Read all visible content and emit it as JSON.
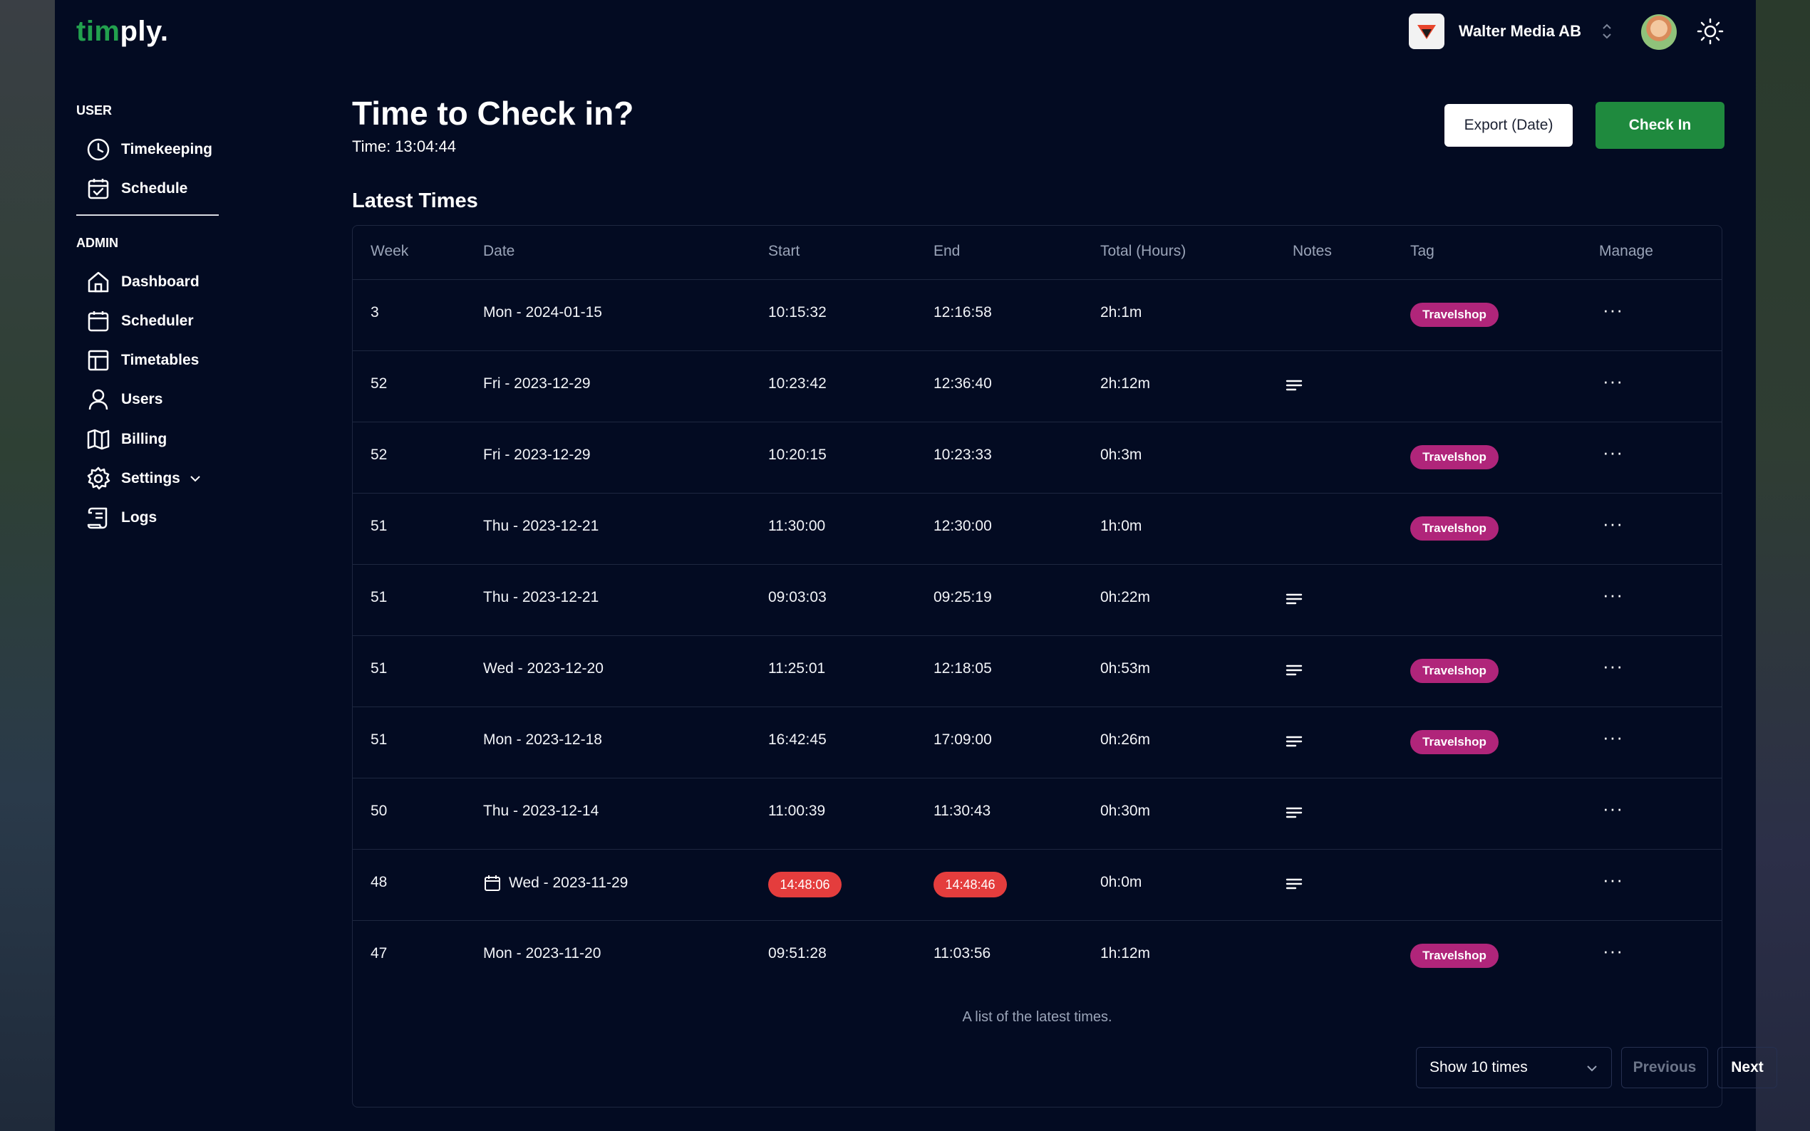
{
  "app": {
    "logo_part1": "tim",
    "logo_part2": "ply.",
    "brand_color": "#22a04e"
  },
  "header": {
    "org_name": "Walter Media AB",
    "theme_icon": "sun-icon"
  },
  "sidebar": {
    "user_section": "USER",
    "user_items": [
      {
        "label": "Timekeeping",
        "icon": "clock-icon"
      },
      {
        "label": "Schedule",
        "icon": "calendar-check-icon"
      }
    ],
    "admin_section": "ADMIN",
    "admin_items": [
      {
        "label": "Dashboard",
        "icon": "home-icon"
      },
      {
        "label": "Scheduler",
        "icon": "calendar-icon"
      },
      {
        "label": "Timetables",
        "icon": "table-icon"
      },
      {
        "label": "Users",
        "icon": "user-icon"
      },
      {
        "label": "Billing",
        "icon": "map-icon"
      },
      {
        "label": "Settings",
        "icon": "gear-icon"
      },
      {
        "label": "Logs",
        "icon": "scroll-icon"
      }
    ]
  },
  "main": {
    "title": "Time to Check in?",
    "time_text": "Time: 13:04:44",
    "export_label": "Export (Date)",
    "checkin_label": "Check In",
    "section_title": "Latest Times"
  },
  "table": {
    "headers": [
      "Week",
      "Date",
      "Start",
      "End",
      "Total (Hours)",
      "Notes",
      "Tag",
      "Manage"
    ],
    "rows": [
      {
        "week": "3",
        "date": "Mon - 2024-01-15",
        "start": "10:15:32",
        "end": "12:16:58",
        "total": "2h:1m",
        "notes": false,
        "tag": "Travelshop"
      },
      {
        "week": "52",
        "date": "Fri - 2023-12-29",
        "start": "10:23:42",
        "end": "12:36:40",
        "total": "2h:12m",
        "notes": true,
        "tag": ""
      },
      {
        "week": "52",
        "date": "Fri - 2023-12-29",
        "start": "10:20:15",
        "end": "10:23:33",
        "total": "0h:3m",
        "notes": false,
        "tag": "Travelshop"
      },
      {
        "week": "51",
        "date": "Thu - 2023-12-21",
        "start": "11:30:00",
        "end": "12:30:00",
        "total": "1h:0m",
        "notes": false,
        "tag": "Travelshop"
      },
      {
        "week": "51",
        "date": "Thu - 2023-12-21",
        "start": "09:03:03",
        "end": "09:25:19",
        "total": "0h:22m",
        "notes": true,
        "tag": ""
      },
      {
        "week": "51",
        "date": "Wed - 2023-12-20",
        "start": "11:25:01",
        "end": "12:18:05",
        "total": "0h:53m",
        "notes": true,
        "tag": "Travelshop"
      },
      {
        "week": "51",
        "date": "Mon - 2023-12-18",
        "start": "16:42:45",
        "end": "17:09:00",
        "total": "0h:26m",
        "notes": true,
        "tag": "Travelshop"
      },
      {
        "week": "50",
        "date": "Thu - 2023-12-14",
        "start": "11:00:39",
        "end": "11:30:43",
        "total": "0h:30m",
        "notes": true,
        "tag": ""
      },
      {
        "week": "48",
        "date": "Wed - 2023-11-29",
        "start": "14:48:06",
        "end": "14:48:46",
        "total": "0h:0m",
        "notes": true,
        "tag": "",
        "flagged": true
      },
      {
        "week": "47",
        "date": "Mon - 2023-11-20",
        "start": "09:51:28",
        "end": "11:03:56",
        "total": "1h:12m",
        "notes": false,
        "tag": "Travelshop"
      }
    ],
    "caption": "A list of the latest times.",
    "tag_color": "#b0257a",
    "flag_color": "#e43d3d"
  },
  "pagination": {
    "page_size_label": "Show 10 times",
    "previous_label": "Previous",
    "next_label": "Next"
  }
}
